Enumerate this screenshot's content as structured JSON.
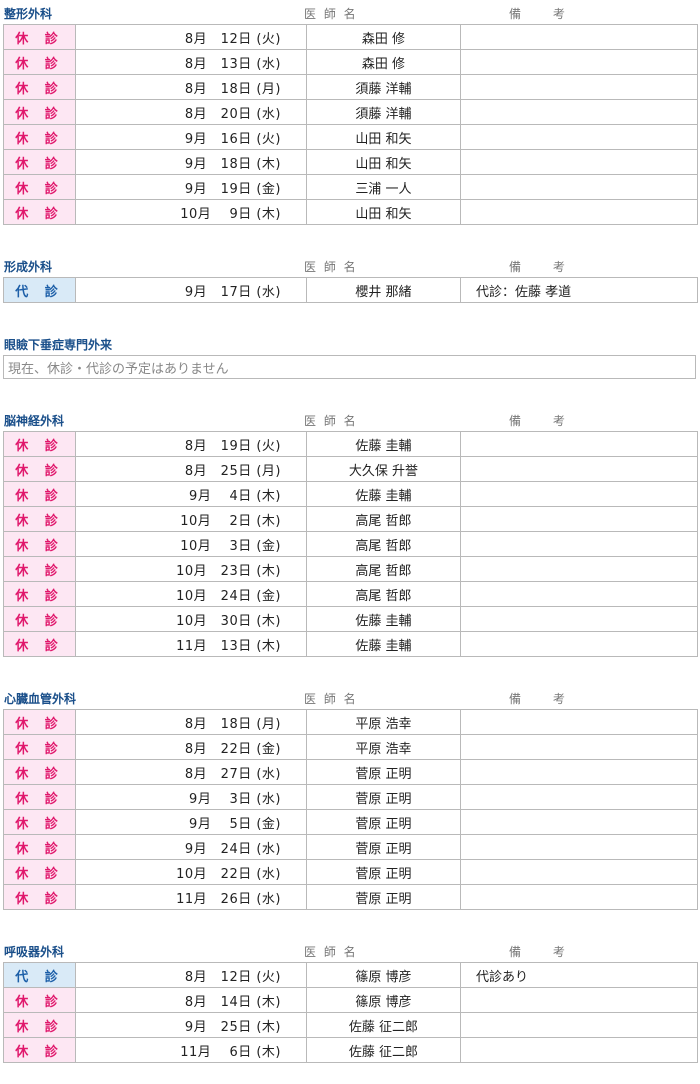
{
  "labels": {
    "doctor_header": "医 師 名",
    "notes_header": "備 考"
  },
  "sections": [
    {
      "dept": "整形外科",
      "rows": [
        {
          "status": "休 診",
          "type": "kyu",
          "date": "8月　12日 (火)",
          "doctor": "森田 修",
          "note": ""
        },
        {
          "status": "休 診",
          "type": "kyu",
          "date": "8月　13日 (水)",
          "doctor": "森田 修",
          "note": ""
        },
        {
          "status": "休 診",
          "type": "kyu",
          "date": "8月　18日 (月)",
          "doctor": "須藤 洋輔",
          "note": ""
        },
        {
          "status": "休 診",
          "type": "kyu",
          "date": "8月　20日 (水)",
          "doctor": "須藤 洋輔",
          "note": ""
        },
        {
          "status": "休 診",
          "type": "kyu",
          "date": "9月　16日 (火)",
          "doctor": "山田 和矢",
          "note": ""
        },
        {
          "status": "休 診",
          "type": "kyu",
          "date": "9月　18日 (木)",
          "doctor": "山田 和矢",
          "note": ""
        },
        {
          "status": "休 診",
          "type": "kyu",
          "date": "9月　19日 (金)",
          "doctor": "三浦 一人",
          "note": ""
        },
        {
          "status": "休 診",
          "type": "kyu",
          "date": "10月　 9日 (木)",
          "doctor": "山田 和矢",
          "note": ""
        }
      ]
    },
    {
      "dept": "形成外科",
      "rows": [
        {
          "status": "代 診",
          "type": "dai",
          "date": "9月　17日 (水)",
          "doctor": "櫻井 那緒",
          "note": "代診：佐藤 孝道"
        }
      ]
    },
    {
      "dept": "眼瞼下垂症専門外来",
      "empty": "現在、休診・代診の予定はありません",
      "rows": []
    },
    {
      "dept": "脳神経外科",
      "rows": [
        {
          "status": "休 診",
          "type": "kyu",
          "date": "8月　19日 (火)",
          "doctor": "佐藤 圭輔",
          "note": ""
        },
        {
          "status": "休 診",
          "type": "kyu",
          "date": "8月　25日 (月)",
          "doctor": "大久保 升誉",
          "note": ""
        },
        {
          "status": "休 診",
          "type": "kyu",
          "date": "9月　 4日 (木)",
          "doctor": "佐藤 圭輔",
          "note": ""
        },
        {
          "status": "休 診",
          "type": "kyu",
          "date": "10月　 2日 (木)",
          "doctor": "高尾 哲郎",
          "note": ""
        },
        {
          "status": "休 診",
          "type": "kyu",
          "date": "10月　 3日 (金)",
          "doctor": "高尾 哲郎",
          "note": ""
        },
        {
          "status": "休 診",
          "type": "kyu",
          "date": "10月　23日 (木)",
          "doctor": "高尾 哲郎",
          "note": ""
        },
        {
          "status": "休 診",
          "type": "kyu",
          "date": "10月　24日 (金)",
          "doctor": "高尾 哲郎",
          "note": ""
        },
        {
          "status": "休 診",
          "type": "kyu",
          "date": "10月　30日 (木)",
          "doctor": "佐藤 圭輔",
          "note": ""
        },
        {
          "status": "休 診",
          "type": "kyu",
          "date": "11月　13日 (木)",
          "doctor": "佐藤 圭輔",
          "note": ""
        }
      ]
    },
    {
      "dept": "心臓血管外科",
      "rows": [
        {
          "status": "休 診",
          "type": "kyu",
          "date": "8月　18日 (月)",
          "doctor": "平原 浩幸",
          "note": ""
        },
        {
          "status": "休 診",
          "type": "kyu",
          "date": "8月　22日 (金)",
          "doctor": "平原 浩幸",
          "note": ""
        },
        {
          "status": "休 診",
          "type": "kyu",
          "date": "8月　27日 (水)",
          "doctor": "菅原 正明",
          "note": ""
        },
        {
          "status": "休 診",
          "type": "kyu",
          "date": "9月　 3日 (水)",
          "doctor": "菅原 正明",
          "note": ""
        },
        {
          "status": "休 診",
          "type": "kyu",
          "date": "9月　 5日 (金)",
          "doctor": "菅原 正明",
          "note": ""
        },
        {
          "status": "休 診",
          "type": "kyu",
          "date": "9月　24日 (水)",
          "doctor": "菅原 正明",
          "note": ""
        },
        {
          "status": "休 診",
          "type": "kyu",
          "date": "10月　22日 (水)",
          "doctor": "菅原 正明",
          "note": ""
        },
        {
          "status": "休 診",
          "type": "kyu",
          "date": "11月　26日 (水)",
          "doctor": "菅原 正明",
          "note": ""
        }
      ]
    },
    {
      "dept": "呼吸器外科",
      "rows": [
        {
          "status": "代 診",
          "type": "dai",
          "date": "8月　12日 (火)",
          "doctor": "篠原 博彦",
          "note": "代診あり"
        },
        {
          "status": "休 診",
          "type": "kyu",
          "date": "8月　14日 (木)",
          "doctor": "篠原 博彦",
          "note": ""
        },
        {
          "status": "休 診",
          "type": "kyu",
          "date": "9月　25日 (木)",
          "doctor": "佐藤 征二郎",
          "note": ""
        },
        {
          "status": "休 診",
          "type": "kyu",
          "date": "11月　 6日 (木)",
          "doctor": "佐藤 征二郎",
          "note": ""
        }
      ]
    }
  ]
}
